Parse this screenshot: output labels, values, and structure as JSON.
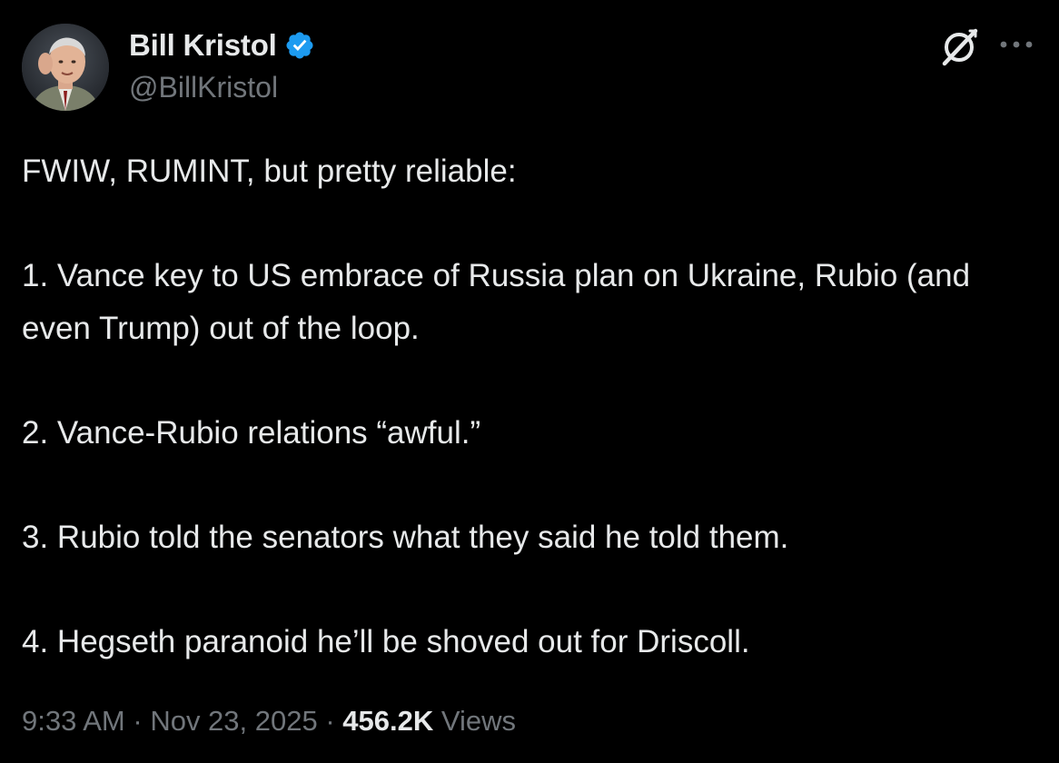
{
  "author": {
    "display_name": "Bill Kristol",
    "handle": "@BillKristol",
    "verified": true,
    "avatar_icon": "profile-photo"
  },
  "header_actions": {
    "grok_icon": "grok-icon",
    "more_icon": "more-options-icon"
  },
  "tweet": {
    "paragraphs": [
      "FWIW, RUMINT, but pretty reliable:",
      "1. Vance key to US embrace of Russia plan on Ukraine, Rubio (and even Trump) out of the loop.",
      "2. Vance-Rubio relations “awful.”",
      "3. Rubio told the senators what they said he told them.",
      "4. Hegseth paranoid he’ll be shoved out for Driscoll."
    ]
  },
  "meta": {
    "time": "9:33 AM",
    "separator": " · ",
    "date": "Nov 23, 2025",
    "views_count": "456.2K",
    "views_label": "Views"
  },
  "colors": {
    "background": "#000000",
    "text_primary": "#e7e9ea",
    "text_secondary": "#71767b",
    "verified_blue": "#1d9bf0"
  }
}
